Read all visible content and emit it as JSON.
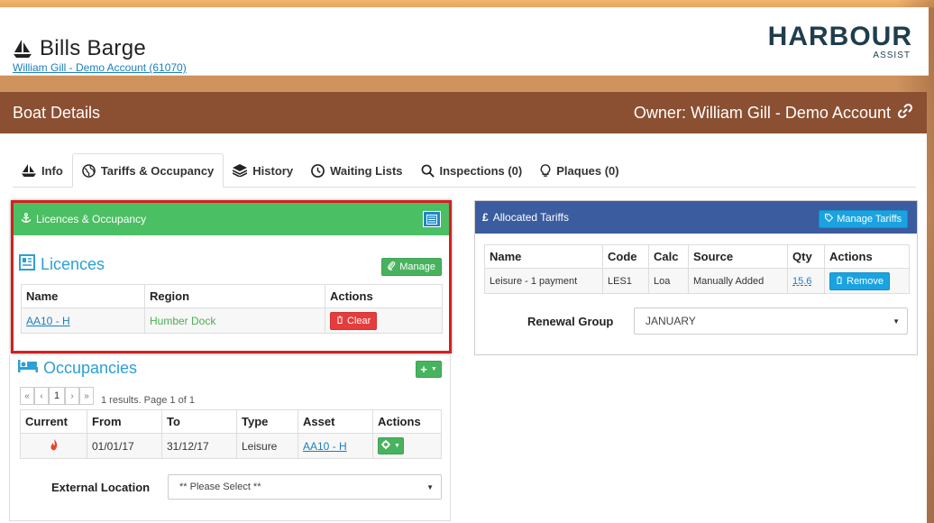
{
  "header": {
    "boat_name": "Bills Barge",
    "account_link": "William Gill - Demo Account (61070)",
    "logo_word": "HARBOUR",
    "logo_sub": "ASSIST"
  },
  "boat_details": {
    "title": "Boat Details",
    "owner": "Owner: William Gill - Demo Account"
  },
  "tabs": [
    {
      "label": "Info",
      "icon": "boat-icon"
    },
    {
      "label": "Tariffs & Occupancy",
      "icon": "globe-icon",
      "active": true
    },
    {
      "label": "History",
      "icon": "layers-icon"
    },
    {
      "label": "Waiting Lists",
      "icon": "clock-icon"
    },
    {
      "label": "Inspections (0)",
      "icon": "search-icon"
    },
    {
      "label": "Plaques (0)",
      "icon": "lightbulb-icon"
    }
  ],
  "licences_panel": {
    "heading": "Licences & Occupancy",
    "licences_title": "Licences",
    "manage_label": "Manage",
    "columns": [
      "Name",
      "Region",
      "Actions"
    ],
    "rows": [
      {
        "name": "AA10 - H",
        "region": "Humber Dock",
        "action": "Clear"
      }
    ]
  },
  "occupancies": {
    "title": "Occupancies",
    "pager": {
      "first": "«",
      "prev": "‹",
      "page": "1",
      "next": "›",
      "last": "»",
      "info": "1 results. Page 1 of 1"
    },
    "columns": [
      "Current",
      "From",
      "To",
      "Type",
      "Asset",
      "Actions"
    ],
    "rows": [
      {
        "from": "01/01/17",
        "to": "31/12/17",
        "type": "Leisure",
        "asset": "AA10 - H"
      }
    ],
    "external_location_label": "External Location",
    "external_location_value": "** Please Select **"
  },
  "tariffs": {
    "heading": "Allocated Tariffs",
    "manage_label": "Manage Tariffs",
    "columns": [
      "Name",
      "Code",
      "Calc",
      "Source",
      "Qty",
      "Actions"
    ],
    "rows": [
      {
        "name": "Leisure - 1 payment",
        "code": "LES1",
        "calc": "Loa",
        "source": "Manually Added",
        "qty": "15.6",
        "action": "Remove"
      }
    ],
    "renewal_label": "Renewal Group",
    "renewal_value": "JANUARY"
  },
  "colors": {
    "boat_header": "#8b4f32",
    "licences_head": "#4bbf63",
    "tariffs_head": "#3b5c9e",
    "link_blue": "#1a7fbf",
    "highlight_red": "#d32020"
  }
}
